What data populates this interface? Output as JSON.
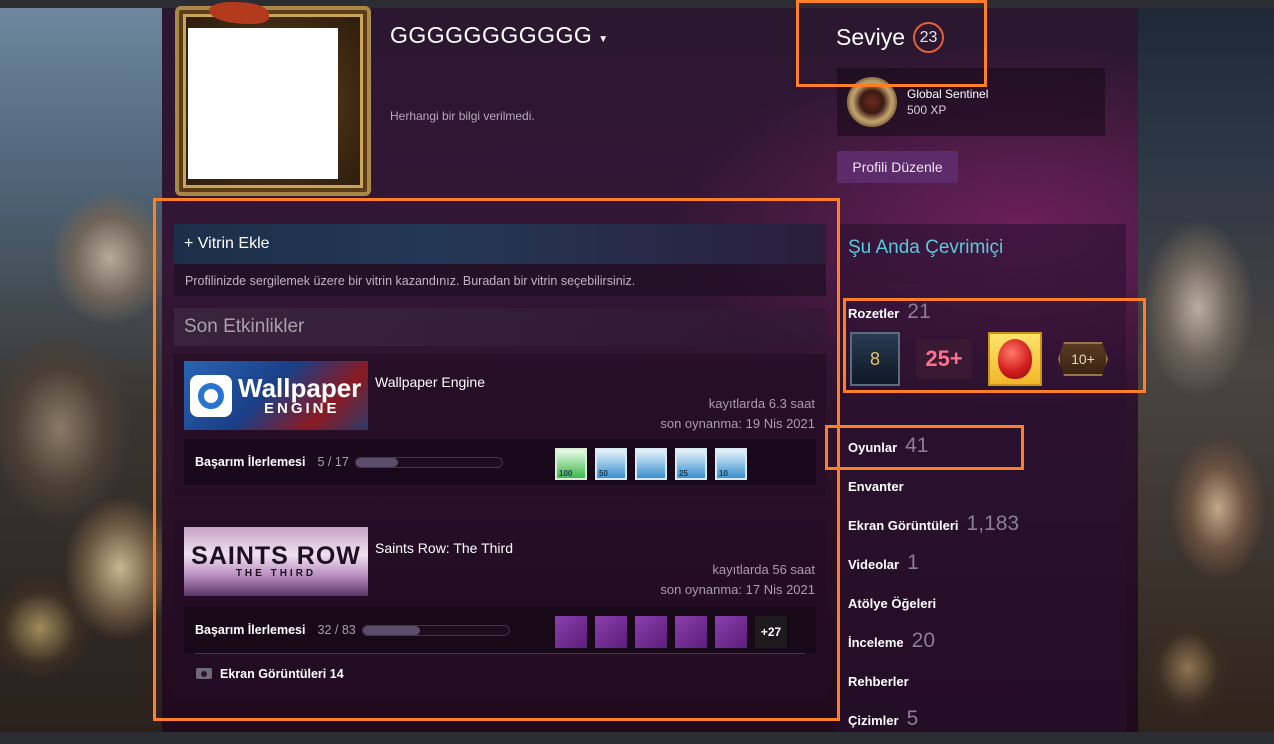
{
  "profile": {
    "username": "GGGGGGGGGGG",
    "summary": "Herhangi bir bilgi verilmedi.",
    "level_label": "Seviye",
    "level": "23",
    "favorite_badge": {
      "name": "Global Sentinel",
      "xp": "500 XP",
      "icon": "sentinel-badge-icon"
    },
    "edit_button": "Profili Düzenle"
  },
  "showcase": {
    "add_label": "+ Vitrin Ekle",
    "description": "Profilinizde sergilemek üzere bir vitrin kazandınız. Buradan bir vitrin seçebilirsiniz."
  },
  "recent": {
    "title": "Son Etkinlikler",
    "games": [
      {
        "name": "Wallpaper Engine",
        "capsule_line1": "Wallpaper",
        "capsule_line2": "ENGINE",
        "hours": "kayıtlarda 6.3 saat",
        "last_played": "son oynanma: 19 Nis 2021",
        "ach_label": "Başarım İlerlemesi",
        "ach_count": "5 / 17",
        "ach_progress": 0.29,
        "ach_icons": [
          {
            "icon": "image-green-icon",
            "num": "100"
          },
          {
            "icon": "image-blue-icon",
            "num": "50"
          },
          {
            "icon": "splash-blue-icon",
            "num": ""
          },
          {
            "icon": "image-blue-icon",
            "num": "25"
          },
          {
            "icon": "image-blue-icon",
            "num": "10"
          }
        ]
      },
      {
        "name": "Saints Row: The Third",
        "capsule_line1": "SAINTS ROW",
        "capsule_line2": "THE THIRD",
        "hours": "kayıtlarda 56 saat",
        "last_played": "son oynanma: 17 Nis 2021",
        "ach_label": "Başarım İlerlemesi",
        "ach_count": "32 / 83",
        "ach_progress": 0.39,
        "ach_more": "+27",
        "screenshots_label": "Ekran Görüntüleri 14"
      }
    ]
  },
  "sidebar": {
    "online_status": "Şu Anda Çevrimiçi",
    "badges": {
      "label": "Rozetler",
      "count": "21",
      "icons": [
        "8",
        "25+",
        "balloon",
        "10+"
      ]
    },
    "stats": [
      {
        "label": "Oyunlar",
        "count": "41"
      },
      {
        "label": "Envanter",
        "count": ""
      },
      {
        "label": "Ekran Görüntüleri",
        "count": "1,183"
      },
      {
        "label": "Videolar",
        "count": "1"
      },
      {
        "label": "Atölye Öğeleri",
        "count": ""
      },
      {
        "label": "İnceleme",
        "count": "20"
      },
      {
        "label": "Rehberler",
        "count": ""
      },
      {
        "label": "Çizimler",
        "count": "5"
      }
    ]
  },
  "colors": {
    "highlight": "#ff7f26",
    "online": "#57cbde",
    "level_ring": "#e0603a",
    "panel": "#341636"
  }
}
